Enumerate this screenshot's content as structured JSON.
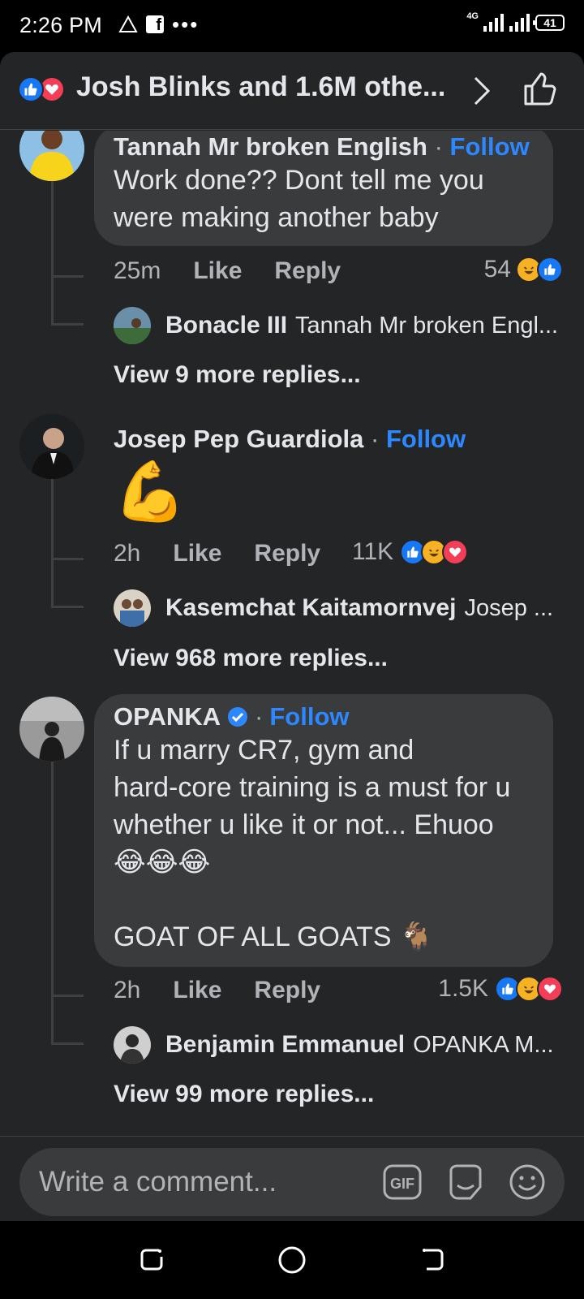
{
  "status_bar": {
    "time": "2:26 PM",
    "network": "4G",
    "battery": "41"
  },
  "header": {
    "title": "Josh Blinks and 1.6M othe..."
  },
  "comments": [
    {
      "name": "Tannah Mr broken English",
      "separator": "·",
      "follow": "Follow",
      "text": "Work done?? Dont tell me you were  making another  baby",
      "time": "25m",
      "like": "Like",
      "reply": "Reply",
      "reaction_count": "54",
      "reactions": [
        "haha",
        "like"
      ],
      "latest_reply": {
        "name": "Bonacle III",
        "snippet": "Tannah Mr broken Engl..."
      },
      "view_more": "View 9 more replies..."
    },
    {
      "name": "Josep Pep Guardiola",
      "separator": "·",
      "follow": "Follow",
      "text": "💪",
      "time": "2h",
      "like": "Like",
      "reply": "Reply",
      "reaction_count": "11K",
      "reactions": [
        "like",
        "haha",
        "love"
      ],
      "latest_reply": {
        "name": "Kasemchat Kaitamornvej",
        "snippet": "Josep ..."
      },
      "view_more": "View 968 more replies..."
    },
    {
      "name": "OPANKA",
      "verified": true,
      "separator": "·",
      "follow": "Follow",
      "text_lines": [
        "If u marry CR7, gym and",
        "hard-core training is a must for u",
        "whether u like it or not... Ehuoo",
        "😂😂😂",
        "",
        "GOAT OF ALL GOATS 🐐"
      ],
      "time": "2h",
      "like": "Like",
      "reply": "Reply",
      "reaction_count": "1.5K",
      "reactions": [
        "like",
        "haha",
        "love"
      ],
      "latest_reply": {
        "name": "Benjamin Emmanuel",
        "snippet": "OPANKA M..."
      },
      "view_more": "View 99 more replies..."
    }
  ],
  "composer": {
    "placeholder": "Write a comment...",
    "gif_label": "GIF"
  },
  "colors": {
    "background": "#242526",
    "bubble": "#3a3b3c",
    "accent": "#2d88ff",
    "like": "#1877f2",
    "love": "#f33e58",
    "haha": "#f7b125"
  }
}
